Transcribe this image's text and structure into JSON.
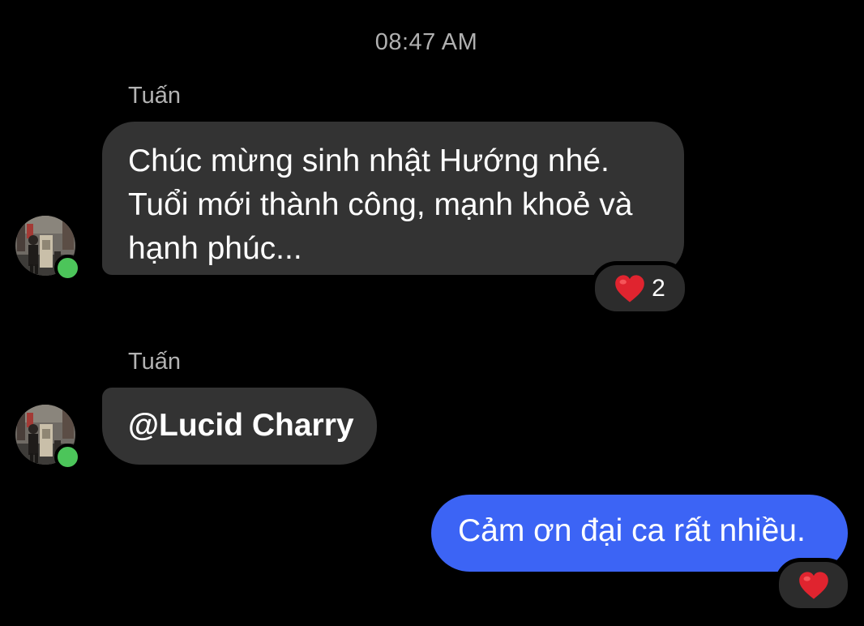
{
  "chat": {
    "timestamp": "08:47 AM",
    "messages": [
      {
        "sender": "Tuấn",
        "lines": [
          "Chúc mừng sinh nhật Hướng nhé.",
          "Tuổi mới thành công, mạnh khoẻ và",
          "hạnh phúc..."
        ],
        "reaction": {
          "icon": "heart-icon",
          "count": "2"
        }
      },
      {
        "sender": "Tuấn",
        "text": "@Lucid Charry"
      },
      {
        "sender": "me",
        "text": "Cảm ơn đại ca rất nhiều.",
        "reaction": {
          "icon": "heart-icon"
        }
      }
    ]
  },
  "colors": {
    "background": "#000000",
    "incoming_bubble": "#333333",
    "outgoing_bubble": "#3c64f5",
    "online_dot": "#4cc55a",
    "heart": "#e0242f"
  }
}
